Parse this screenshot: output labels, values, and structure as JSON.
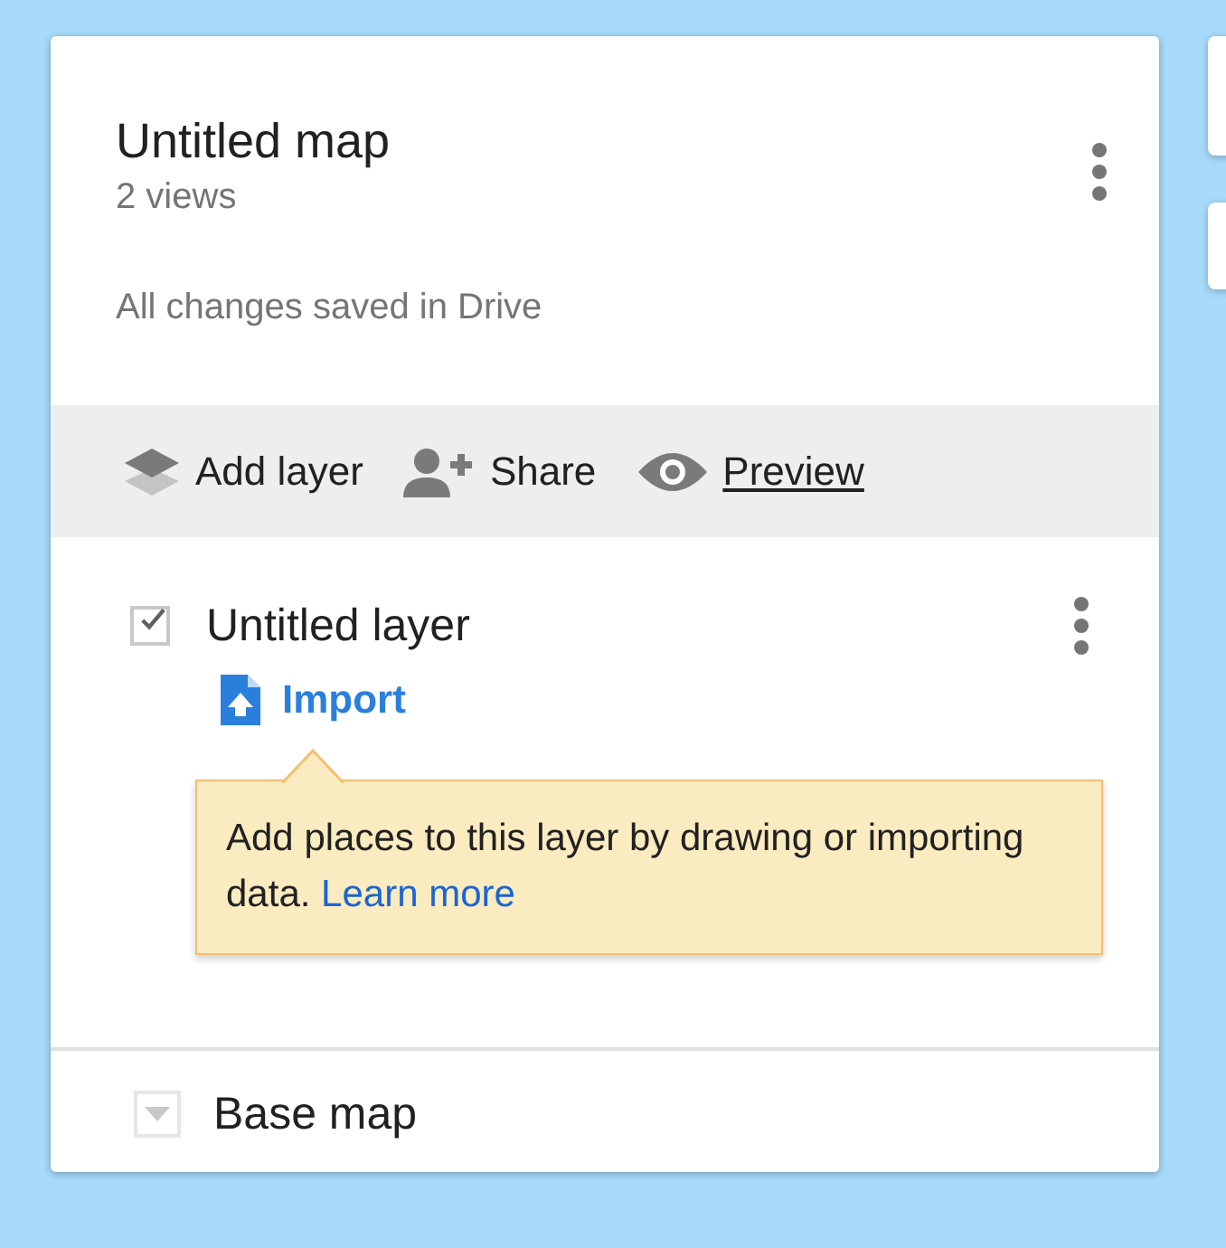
{
  "map": {
    "title": "Untitled map",
    "views": "2 views",
    "save_status": "All changes saved in Drive"
  },
  "toolbar": [
    {
      "kind": "add-layer",
      "label": "Add layer"
    },
    {
      "kind": "share",
      "label": "Share"
    },
    {
      "kind": "preview",
      "label": "Preview"
    }
  ],
  "layers": [
    {
      "name": "Untitled layer",
      "checked": true,
      "import_label": "Import",
      "tooltip": {
        "text": "Add places to this layer by drawing or importing data.",
        "link": "Learn more"
      }
    }
  ],
  "base_map": {
    "label": "Base map"
  }
}
